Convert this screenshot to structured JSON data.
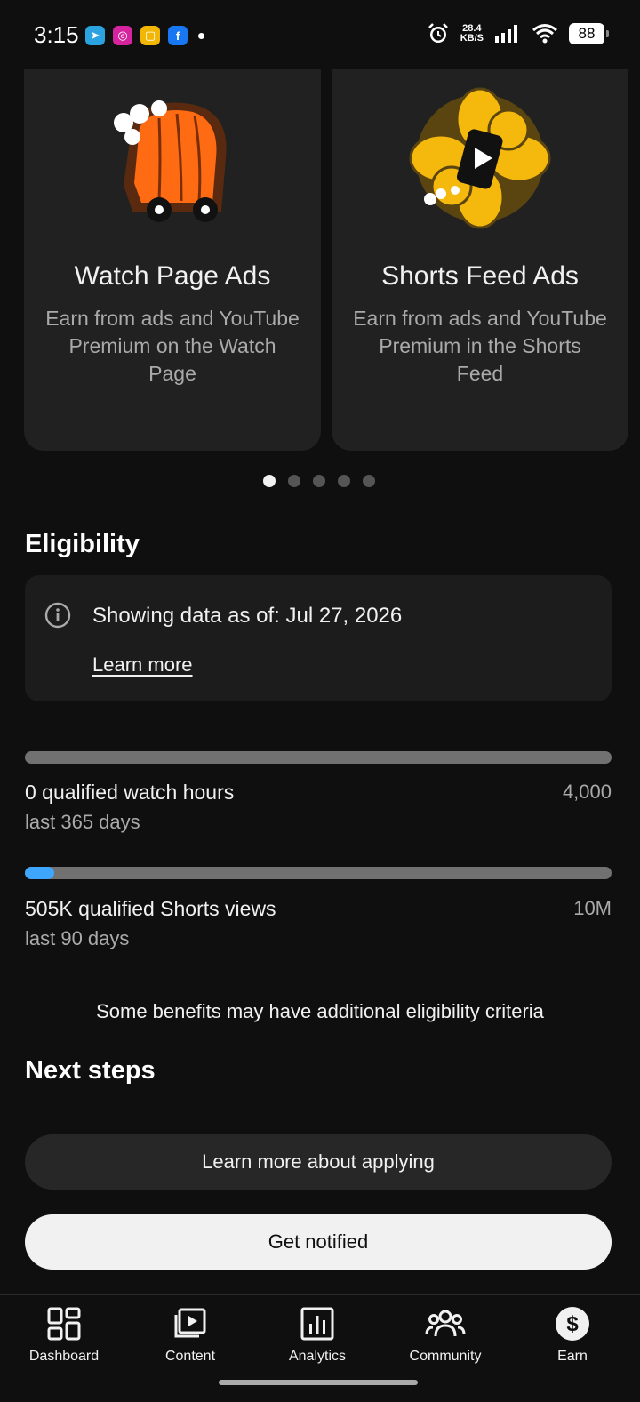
{
  "status_bar": {
    "time": "3:15",
    "net_speed_value": "28.4",
    "net_speed_unit": "KB/S",
    "battery": "88"
  },
  "cards": [
    {
      "title": "Watch Page Ads",
      "description": "Earn from ads and YouTube Premium on the Watch Page"
    },
    {
      "title": "Shorts Feed Ads",
      "description": "Earn from ads and YouTube Premium in the Shorts Feed"
    }
  ],
  "pager": {
    "count": 5,
    "active_index": 0
  },
  "eligibility": {
    "title": "Eligibility",
    "info_text": "Showing data as of: Jul 27, 2026",
    "learn_more": "Learn more"
  },
  "metrics": [
    {
      "label": "0 qualified watch hours",
      "goal": "4,000",
      "sub": "last 365 days",
      "progress_fraction": 0.0
    },
    {
      "label": "505K qualified Shorts views",
      "goal": "10M",
      "sub": "last 90 days",
      "progress_fraction": 0.0505
    }
  ],
  "note": "Some benefits may have additional eligibility criteria",
  "next_steps": {
    "title": "Next steps",
    "learn_button": "Learn more about applying",
    "notify_button": "Get notified"
  },
  "bottom_nav": [
    {
      "label": "Dashboard",
      "icon": "dashboard-icon"
    },
    {
      "label": "Content",
      "icon": "content-icon"
    },
    {
      "label": "Analytics",
      "icon": "analytics-icon"
    },
    {
      "label": "Community",
      "icon": "community-icon"
    },
    {
      "label": "Earn",
      "icon": "earn-icon"
    }
  ],
  "colors": {
    "background": "#0f0f0f",
    "card": "#212121",
    "progress_fill": "#3ea6ff",
    "progress_track": "#717171"
  }
}
